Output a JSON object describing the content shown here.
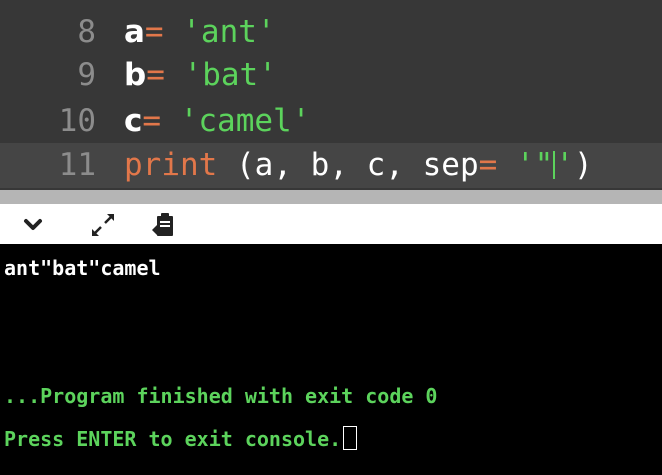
{
  "editor": {
    "lines": [
      {
        "number": "8",
        "var": "a",
        "op": "=",
        "value": "'ant'"
      },
      {
        "number": "9",
        "var": "b",
        "op": "=",
        "value": "'bat'"
      },
      {
        "number": "10",
        "var": "c",
        "op": "=",
        "value": "'camel'"
      },
      {
        "number": "11",
        "keyword": "print",
        "args_open": "(a, b, c, sep",
        "op": "=",
        "value_open": "'\"",
        "value_close": "'",
        "args_close": ")"
      }
    ]
  },
  "toolbar": {
    "icons": [
      "chevron-down-icon",
      "expand-icon",
      "clipboard-icon"
    ]
  },
  "console": {
    "output": "ant\"bat\"camel",
    "exit_message": "...Program finished with exit code 0",
    "prompt": "Press ENTER to exit console."
  },
  "colors": {
    "editor_bg": "#373737",
    "string": "#5cd35c",
    "operator": "#e2774a",
    "console_bg": "#000000",
    "console_status": "#5cd35c"
  }
}
